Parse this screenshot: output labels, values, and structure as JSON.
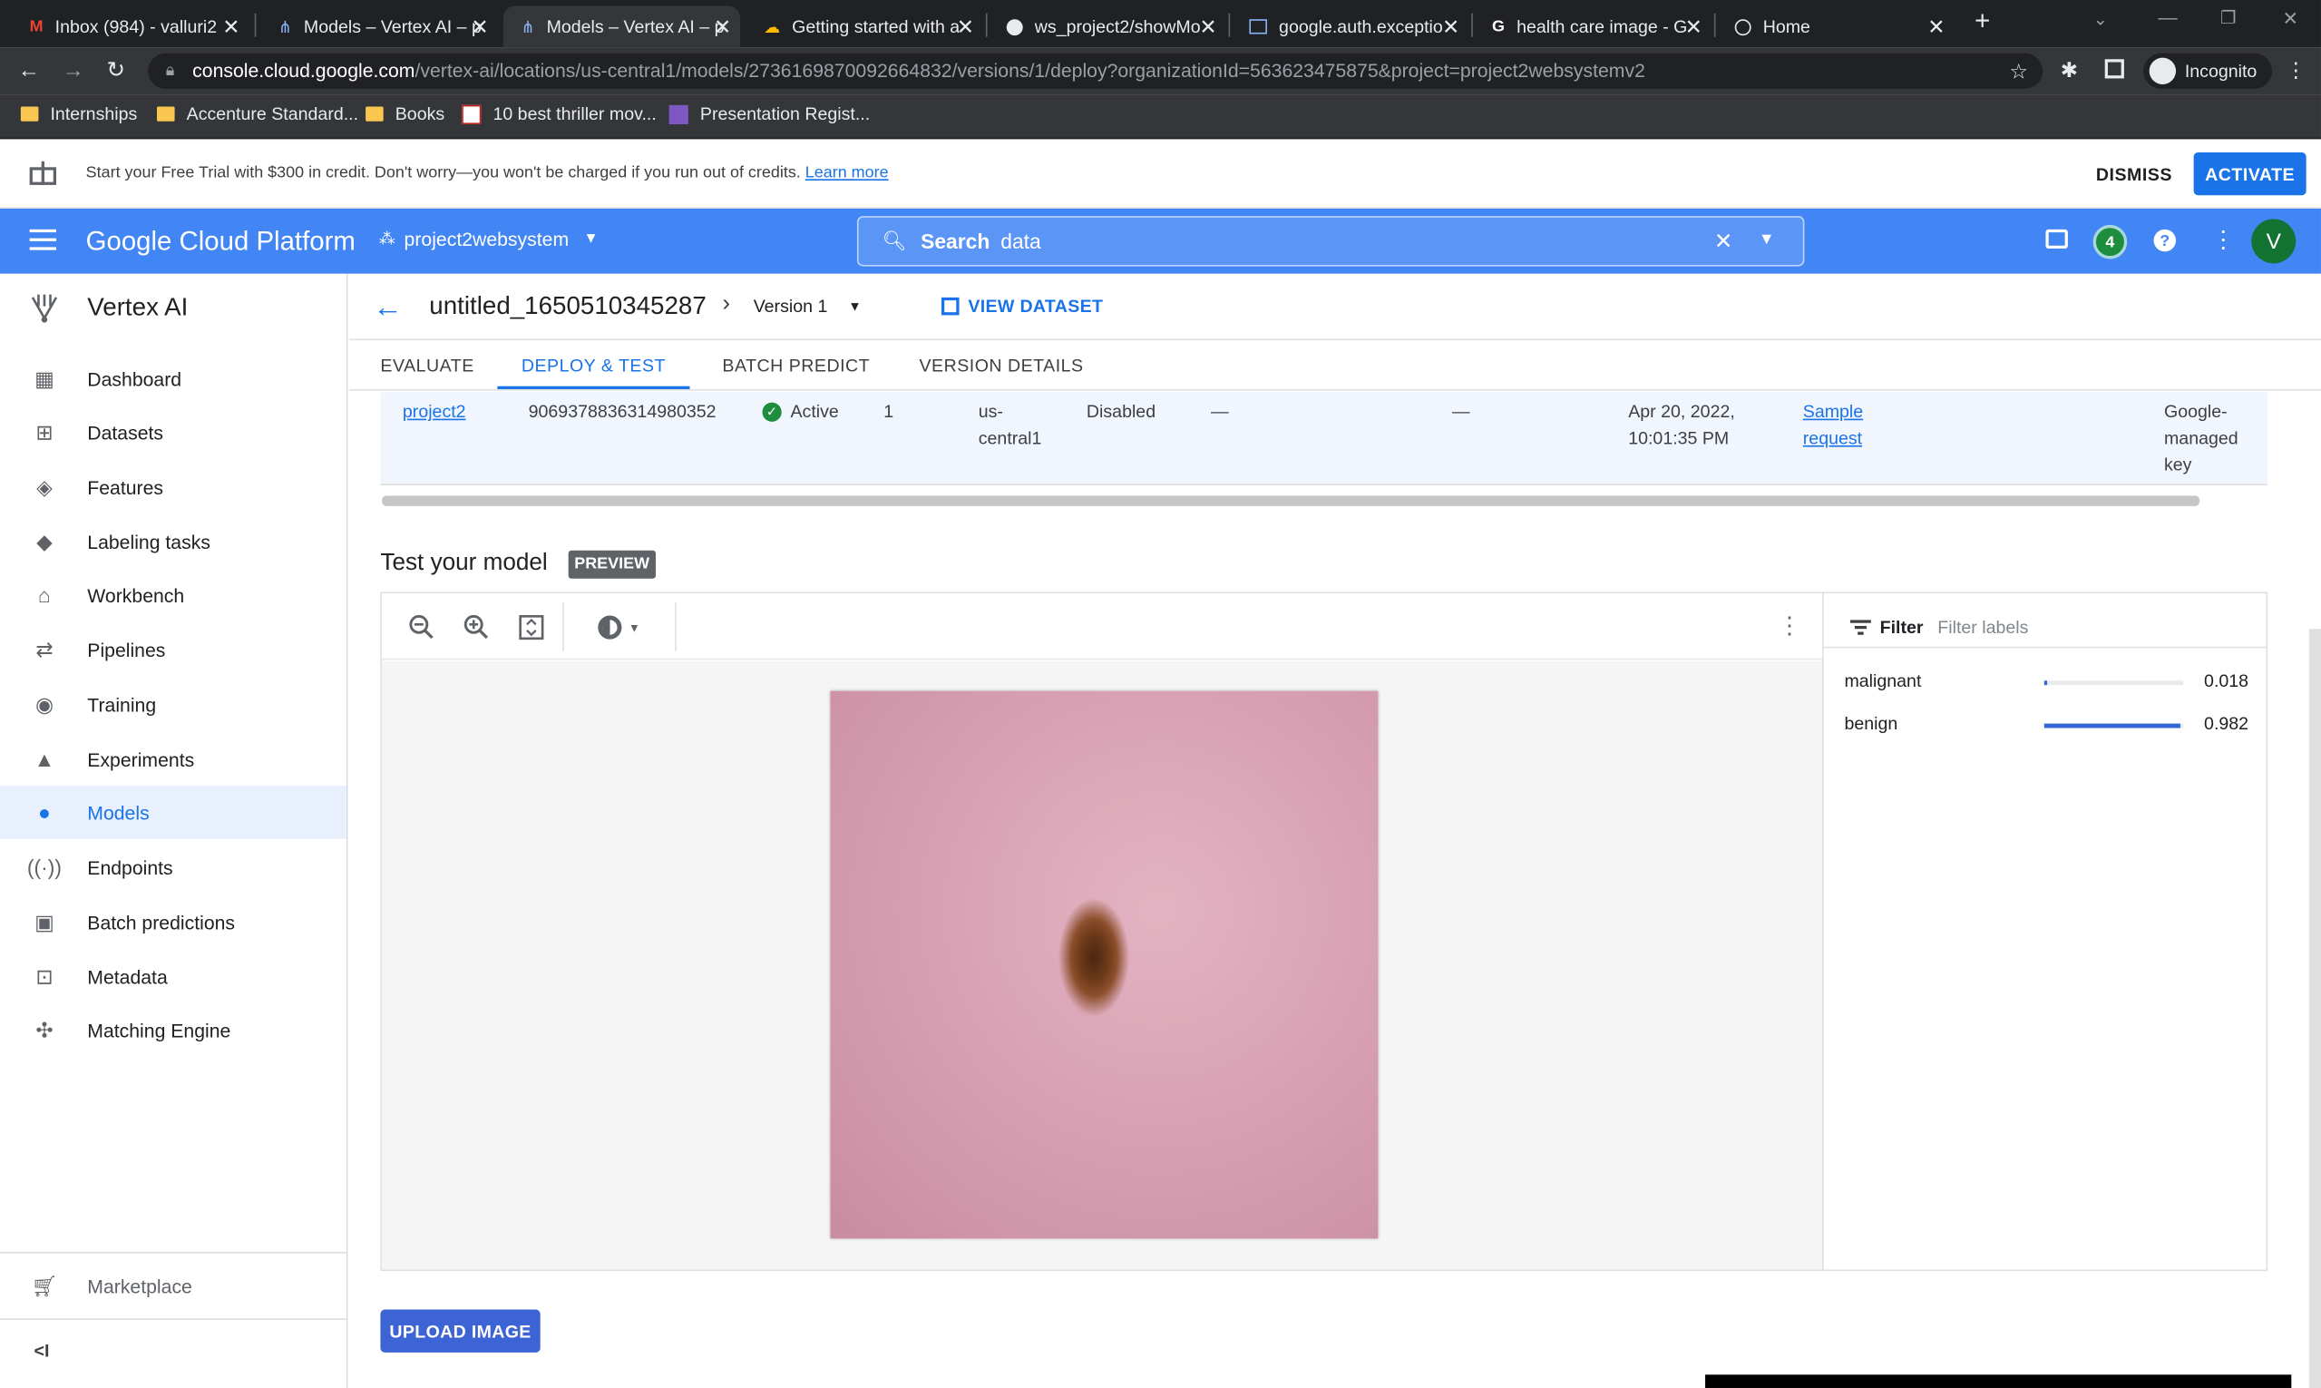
{
  "browser": {
    "tabs": [
      {
        "title": "Inbox (984) - valluri2",
        "icon": "gmail-icon"
      },
      {
        "title": "Models – Vertex AI – p",
        "icon": "vertex-ai-icon"
      },
      {
        "title": "Models – Vertex AI – p",
        "icon": "vertex-ai-icon",
        "active": true
      },
      {
        "title": "Getting started with a",
        "icon": "google-cloud-icon"
      },
      {
        "title": "ws_project2/showMo",
        "icon": "github-icon"
      },
      {
        "title": "google.auth.exceptio",
        "icon": "terminal-icon"
      },
      {
        "title": "health care image - G",
        "icon": "google-icon"
      },
      {
        "title": "Home",
        "icon": "globe-icon"
      }
    ],
    "url_host": "console.cloud.google.com",
    "url_path": "/vertex-ai/locations/us-central1/models/2736169870092664832/versions/1/deploy?organizationId=563623475875&project=project2websystemv2",
    "profile_label": "Incognito",
    "bookmarks": [
      {
        "label": "Internships",
        "icon": "folder-icon"
      },
      {
        "label": "Accenture Standard...",
        "icon": "folder-icon"
      },
      {
        "label": "Books",
        "icon": "folder-icon"
      },
      {
        "label": "10 best thriller mov...",
        "icon": "bookmark-icon"
      },
      {
        "label": "Presentation Regist...",
        "icon": "form-icon"
      }
    ]
  },
  "trial_banner": {
    "text": "Start your Free Trial with $300 in credit. Don't worry—you won't be charged if you run out of credits.",
    "link": "Learn more",
    "dismiss": "DISMISS",
    "activate": "ACTIVATE"
  },
  "header": {
    "product": "Google Cloud Platform",
    "project": "project2websystem",
    "search_label": "Search",
    "search_value": "data",
    "notification_count": "4",
    "avatar_letter": "V"
  },
  "sidenav": {
    "title": "Vertex AI",
    "items": [
      {
        "label": "Dashboard",
        "icon": "dashboard-icon"
      },
      {
        "label": "Datasets",
        "icon": "datasets-icon"
      },
      {
        "label": "Features",
        "icon": "features-icon"
      },
      {
        "label": "Labeling tasks",
        "icon": "label-icon"
      },
      {
        "label": "Workbench",
        "icon": "workbench-icon"
      },
      {
        "label": "Pipelines",
        "icon": "pipelines-icon"
      },
      {
        "label": "Training",
        "icon": "training-icon"
      },
      {
        "label": "Experiments",
        "icon": "experiments-icon"
      },
      {
        "label": "Models",
        "icon": "models-icon",
        "selected": true
      },
      {
        "label": "Endpoints",
        "icon": "endpoints-icon"
      },
      {
        "label": "Batch predictions",
        "icon": "batch-predictions-icon"
      },
      {
        "label": "Metadata",
        "icon": "metadata-icon"
      },
      {
        "label": "Matching Engine",
        "icon": "matching-engine-icon"
      }
    ],
    "marketplace": "Marketplace",
    "collapse": "<I"
  },
  "page": {
    "model_name": "untitled_1650510345287",
    "version": "Version 1",
    "view_dataset": "VIEW DATASET",
    "tabs": [
      "EVALUATE",
      "DEPLOY & TEST",
      "BATCH PREDICT",
      "VERSION DETAILS"
    ],
    "selected_tab": "DEPLOY & TEST",
    "endpoint_row": {
      "name": "project2",
      "id": "9069378836314980352",
      "status": "Active",
      "models": "1",
      "region": "us-central1",
      "monitoring": "Disabled",
      "dash1": "—",
      "dash2": "—",
      "updated": "Apr 20, 2022, 10:01:35 PM",
      "sample_request": "Sample request",
      "encryption": "Google-managed key"
    },
    "test_title": "Test your model",
    "preview_badge": "PREVIEW",
    "filter_label": "Filter",
    "filter_placeholder": "Filter labels",
    "predictions": [
      {
        "label": "malignant",
        "score": "0.018",
        "fraction": 0.018
      },
      {
        "label": "benign",
        "score": "0.982",
        "fraction": 0.982
      }
    ],
    "upload_button": "UPLOAD IMAGE"
  }
}
